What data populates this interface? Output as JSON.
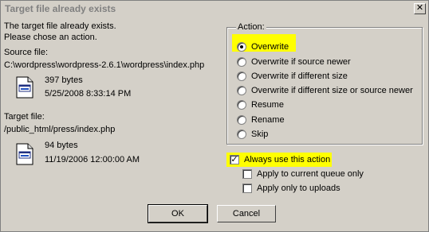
{
  "window": {
    "title": "Target file already exists",
    "close_glyph": "✕"
  },
  "message": {
    "line1": "The target file already exists.",
    "line2": "Please chose an action."
  },
  "source": {
    "label": "Source file:",
    "path": "C:\\wordpress\\wordpress-2.6.1\\wordpress\\index.php",
    "size": "397 bytes",
    "date": "5/25/2008 8:33:14 PM"
  },
  "target": {
    "label": "Target file:",
    "path": "/public_html/press/index.php",
    "size": "94 bytes",
    "date": "11/19/2006 12:00:00 AM"
  },
  "action_group": {
    "label": "Action:",
    "options": [
      {
        "label": "Overwrite",
        "checked": true
      },
      {
        "label": "Overwrite if source newer",
        "checked": false
      },
      {
        "label": "Overwrite if different size",
        "checked": false
      },
      {
        "label": "Overwrite if different size or source newer",
        "checked": false
      },
      {
        "label": "Resume",
        "checked": false
      },
      {
        "label": "Rename",
        "checked": false
      },
      {
        "label": "Skip",
        "checked": false
      }
    ]
  },
  "options": {
    "always_use": {
      "label": "Always use this action",
      "checked": true
    },
    "current_queue": {
      "label": "Apply to current queue only",
      "checked": false
    },
    "uploads_only": {
      "label": "Apply only to uploads",
      "checked": false
    }
  },
  "buttons": {
    "ok": "OK",
    "cancel": "Cancel"
  },
  "colors": {
    "highlight": "#ffff00",
    "dialog_bg": "#d4d0c8"
  }
}
